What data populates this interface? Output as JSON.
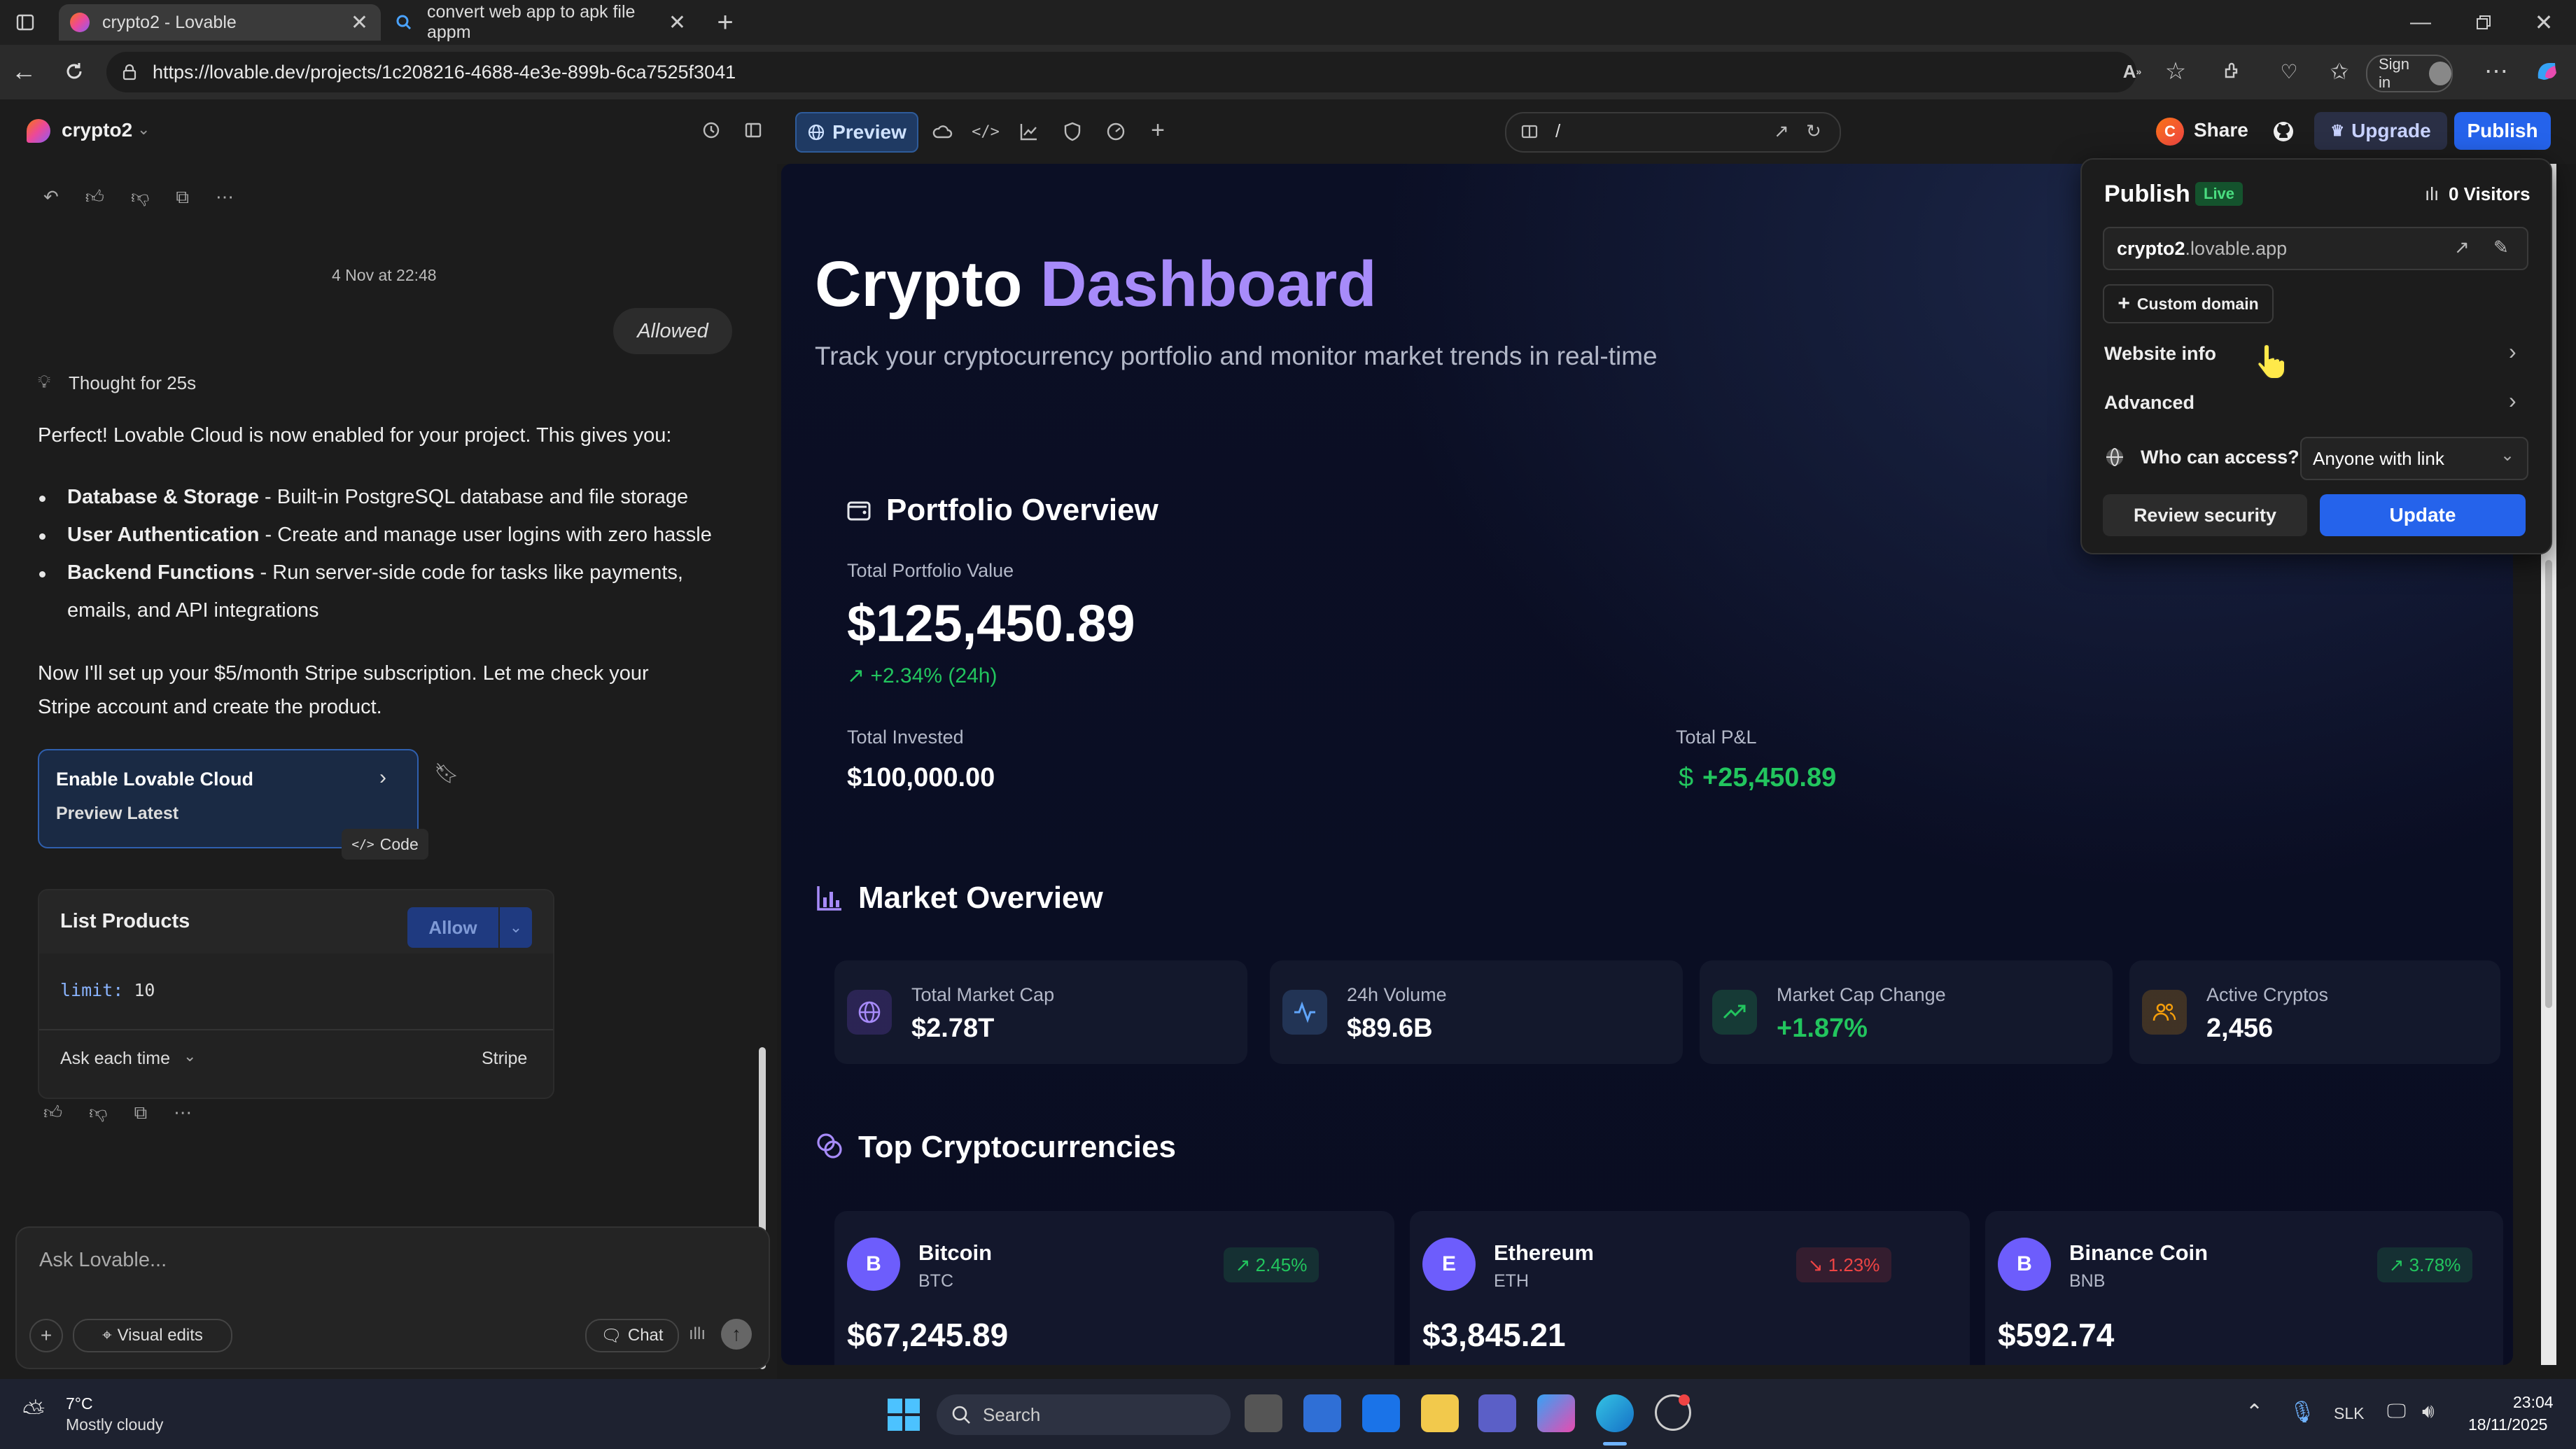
{
  "browser": {
    "tabs": [
      {
        "title": "crypto2 - Lovable",
        "active": true
      },
      {
        "title": "convert web app to apk file appm",
        "active": false
      }
    ],
    "url": "https://lovable.dev/projects/1c208216-4688-4e3e-899b-6ca7525f3041",
    "sign_in": "Sign in"
  },
  "lovable": {
    "project_name": "crypto2",
    "preview_label": "Preview",
    "path": "/",
    "share": "Share",
    "upgrade": "Upgrade",
    "publish": "Publish",
    "avatar_letter": "C"
  },
  "chat": {
    "timestamp": "4 Nov at 22:48",
    "allowed": "Allowed",
    "thought": "Thought for 25s",
    "intro": "Perfect! Lovable Cloud is now enabled for your project. This gives you:",
    "bullets": [
      {
        "bold": "Database & Storage",
        "text": " - Built-in PostgreSQL database and file storage"
      },
      {
        "bold": "User Authentication",
        "text": " - Create and manage user logins with zero hassle"
      },
      {
        "bold": "Backend Functions",
        "text": " - Run server-side code for tasks like payments,"
      }
    ],
    "bullet3_cont": "emails, and API integrations",
    "para2_line1": "Now I'll set up your $5/month Stripe subscription. Let me check your",
    "para2_line2": "Stripe account and create the product.",
    "card_title": "Enable Lovable Cloud",
    "card_sub": "Preview Latest",
    "code_label": "Code",
    "tool_title": "List Products",
    "allow": "Allow",
    "param_key": "limit:",
    "param_val": "10",
    "ask_each_time": "Ask each time",
    "provider": "Stripe",
    "input_placeholder": "Ask Lovable...",
    "visual_edits": "Visual edits",
    "chat_btn": "Chat"
  },
  "preview": {
    "title_a": "Crypto",
    "title_b": "Dashboard",
    "subtitle": "Track your cryptocurrency portfolio and monitor market trends in real-time",
    "portfolio": {
      "heading": "Portfolio Overview",
      "total_label": "Total Portfolio Value",
      "total_value": "$125,450.89",
      "change": "+2.34% (24h)",
      "invested_label": "Total Invested",
      "invested_value": "$100,000.00",
      "pnl_label": "Total P&L",
      "pnl_value": "+25,450.89",
      "pnl_symbol": "$"
    },
    "market": {
      "heading": "Market Overview",
      "stats": [
        {
          "label": "Total Market Cap",
          "value": "$2.78T",
          "icon": "globe-icon",
          "color": "#8b5cf6"
        },
        {
          "label": "24h Volume",
          "value": "$89.6B",
          "icon": "activity-icon",
          "color": "#60a5fa"
        },
        {
          "label": "Market Cap Change",
          "value": "+1.87%",
          "icon": "trending-up-icon",
          "color": "#22c55e"
        },
        {
          "label": "Active Cryptos",
          "value": "2,456",
          "icon": "users-icon",
          "color": "#f59e0b"
        }
      ]
    },
    "top": {
      "heading": "Top Cryptocurrencies",
      "coins": [
        {
          "letter": "B",
          "name": "Bitcoin",
          "symbol": "BTC",
          "change": "2.45%",
          "price": "$67,245.89",
          "up": true
        },
        {
          "letter": "E",
          "name": "Ethereum",
          "symbol": "ETH",
          "change": "1.23%",
          "price": "$3,845.21",
          "up": false
        },
        {
          "letter": "B",
          "name": "Binance Coin",
          "symbol": "BNB",
          "change": "3.78%",
          "price": "$592.74",
          "up": true
        }
      ]
    }
  },
  "publish_panel": {
    "title": "Publish",
    "live": "Live",
    "visitors": "0 Visitors",
    "domain_bold": "crypto2",
    "domain_rest": ".lovable.app",
    "custom_domain": "Custom domain",
    "website_info": "Website info",
    "advanced": "Advanced",
    "who_access": "Who can access?",
    "access_value": "Anyone with link",
    "review_security": "Review security",
    "update": "Update"
  },
  "taskbar": {
    "temp": "7°C",
    "weather": "Mostly cloudy",
    "search": "Search",
    "lang": "SLK",
    "time": "23:04",
    "date": "18/11/2025"
  },
  "colors": {
    "accent_blue": "#2563eb",
    "purple": "#8b5cf6",
    "green": "#22c55e",
    "red": "#ef4444"
  }
}
